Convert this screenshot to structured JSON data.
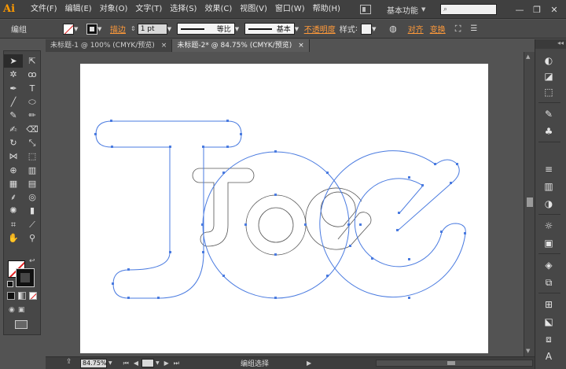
{
  "app": {
    "logo": "Ai",
    "workspace": "基本功能",
    "accent": "#ff9a00"
  },
  "menu": [
    "文件(F)",
    "编辑(E)",
    "对象(O)",
    "文字(T)",
    "选择(S)",
    "效果(C)",
    "视图(V)",
    "窗口(W)",
    "帮助(H)"
  ],
  "window_controls": [
    "—",
    "❐",
    "✕"
  ],
  "control_bar": {
    "selection_label": "编组",
    "stroke_label": "描边",
    "stroke_weight": "1 pt",
    "stroke_profile": "等比",
    "brush": "基本",
    "opacity_label": "不透明度",
    "style_label": "样式",
    "align_label": "对齐",
    "transform_label": "变换"
  },
  "tabs": [
    {
      "title": "未标题-1 @ 100% (CMYK/预览)",
      "close": "×",
      "active": false
    },
    {
      "title": "未标题-2* @ 84.75% (CMYK/预览)",
      "close": "×",
      "active": true
    }
  ],
  "status_bar": {
    "zoom": "84.75%",
    "tool_status": "编组选择"
  },
  "colors": {
    "path_blue": "#4a7be0",
    "stroke_none_red": "#e02020",
    "artboard": "#ffffff"
  },
  "tools": [
    "selection-tool",
    "direct-selection-tool",
    "magic-wand-tool",
    "lasso-tool",
    "pen-tool",
    "type-tool",
    "line-tool",
    "ellipse-tool",
    "paintbrush-tool",
    "pencil-tool",
    "blob-brush-tool",
    "eraser-tool",
    "rotate-tool",
    "scale-tool",
    "width-tool",
    "free-transform-tool",
    "shape-builder-tool",
    "perspective-grid-tool",
    "mesh-tool",
    "gradient-tool",
    "eyedropper-tool",
    "blend-tool",
    "symbol-sprayer-tool",
    "column-graph-tool",
    "artboard-tool",
    "slice-tool",
    "hand-tool",
    "zoom-tool"
  ],
  "right_panel_icons": [
    "color-icon",
    "color-guide-icon",
    "swatches-icon",
    "brushes-icon",
    "symbols-icon",
    "stroke-icon",
    "gradient-icon",
    "transparency-icon",
    "appearance-icon",
    "graphic-styles-icon",
    "layers-icon",
    "artboards-icon",
    "align-icon",
    "transform-icon",
    "pathfinder-icon",
    "character-icon"
  ]
}
